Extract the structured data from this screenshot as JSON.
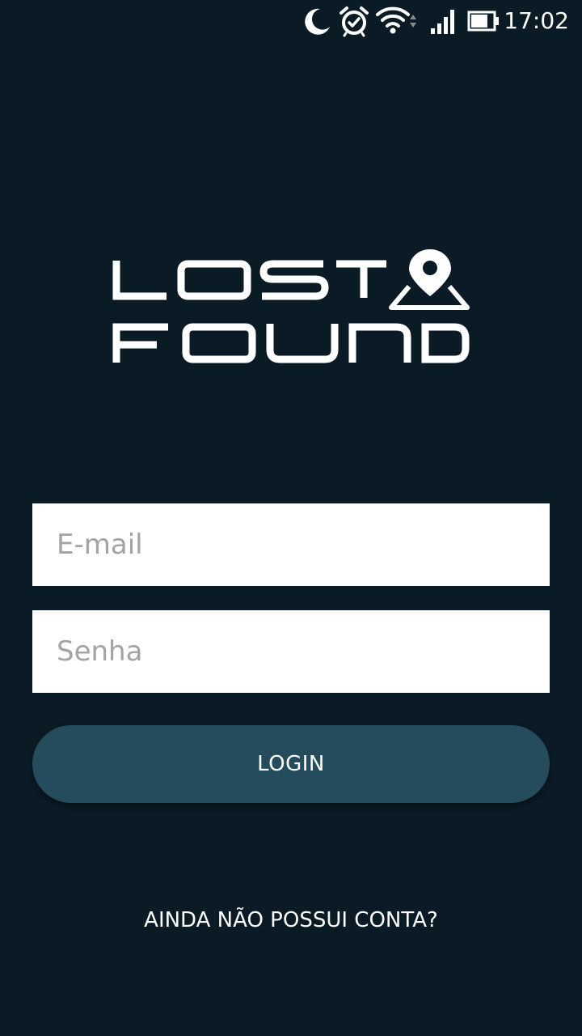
{
  "status_bar": {
    "time": "17:02",
    "icons": [
      "moon-icon",
      "alarm-icon",
      "wifi-icon",
      "signal-icon",
      "battery-icon"
    ]
  },
  "logo": {
    "line1": "LOST",
    "line2": "FOUND"
  },
  "form": {
    "email_placeholder": "E-mail",
    "password_placeholder": "Senha",
    "login_label": "LOGIN"
  },
  "footer": {
    "signup_label": "AINDA NÃO POSSUI CONTA?"
  },
  "colors": {
    "background": "#0a1b25",
    "button": "#244c5c",
    "field": "#ffffff",
    "placeholder": "#a3a3a3"
  }
}
